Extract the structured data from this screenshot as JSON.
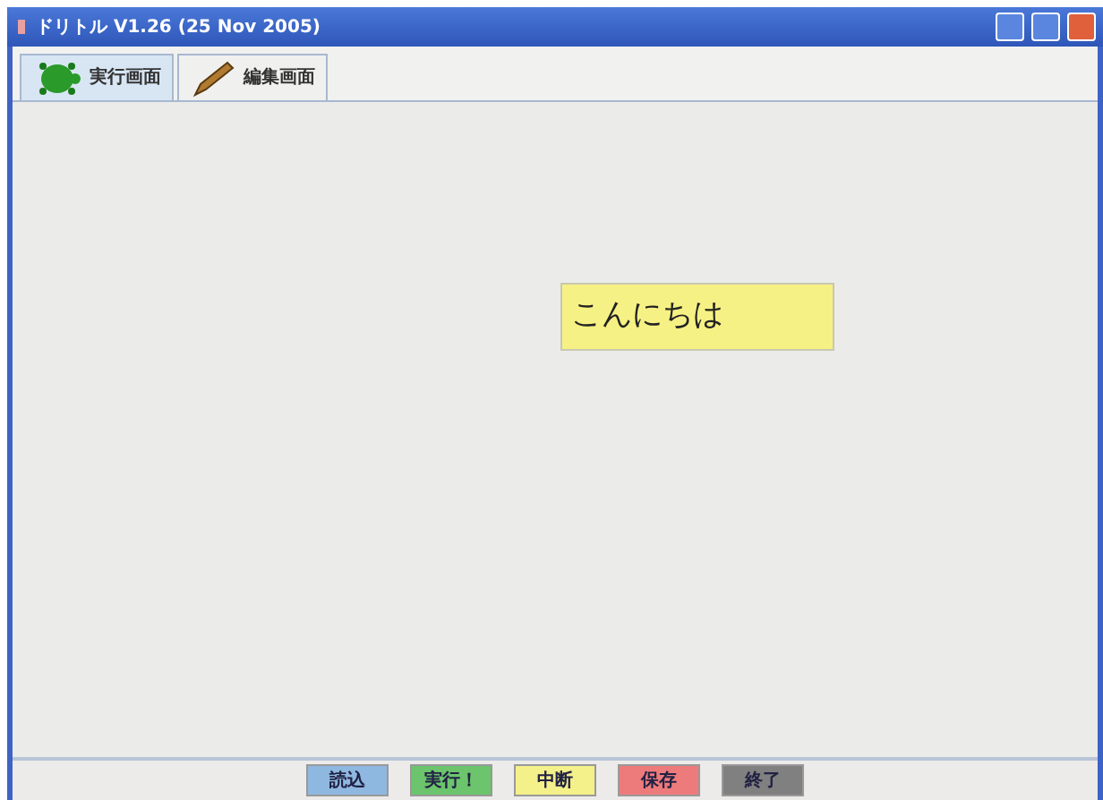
{
  "window": {
    "title": "ドリトル V1.26 (25 Nov 2005)"
  },
  "tabs": [
    {
      "label": "実行画面",
      "selected": true
    },
    {
      "label": "編集画面",
      "selected": false
    }
  ],
  "canvas": {
    "label": "こんにちは"
  },
  "buttons": [
    {
      "label": "読込",
      "color": "#8fb8e0"
    },
    {
      "label": "実行！",
      "color": "#6cc46c"
    },
    {
      "label": "中断",
      "color": "#f4f08a"
    },
    {
      "label": "保存",
      "color": "#ee7b7b"
    },
    {
      "label": "終了",
      "color": "#808080"
    }
  ]
}
